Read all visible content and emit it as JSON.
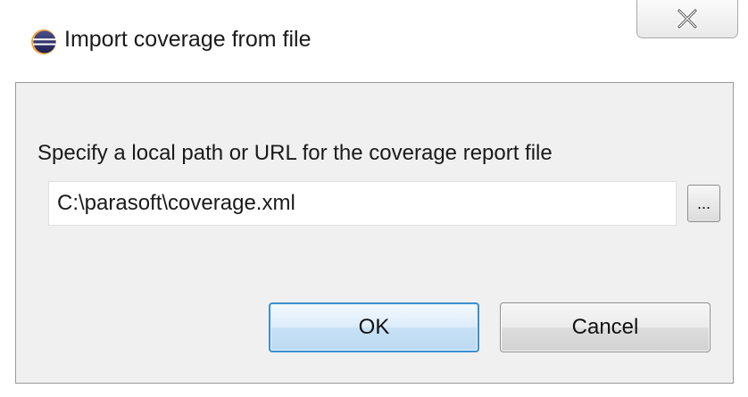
{
  "window": {
    "title": "Import coverage from file",
    "icon": "eclipse-icon",
    "close_icon": "close-icon"
  },
  "form": {
    "prompt": "Specify a local path or URL for the coverage report file",
    "path_value": "C:\\parasoft\\coverage.xml",
    "browse_label": "..."
  },
  "buttons": {
    "ok_label": "OK",
    "cancel_label": "Cancel"
  },
  "colors": {
    "dialog_background": "#f0f0f0",
    "default_button_border": "#3c8fcf"
  }
}
